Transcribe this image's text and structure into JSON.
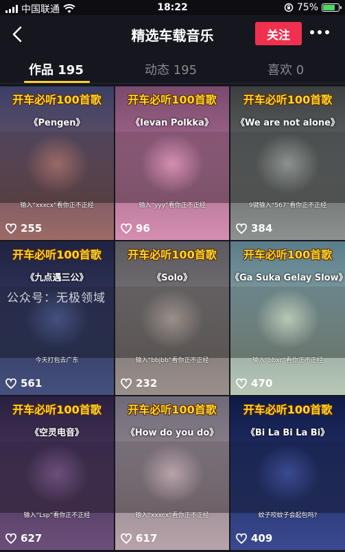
{
  "status_bar": {
    "carrier": "中国联通",
    "time": "18:22",
    "battery": "75%",
    "battery_level": 0.75
  },
  "header": {
    "title": "精选车载音乐",
    "follow_label": "关注"
  },
  "tabs": [
    {
      "label": "作品 195",
      "active": true
    },
    {
      "label": "动态 195",
      "active": false
    },
    {
      "label": "喜欢 0",
      "active": false
    }
  ],
  "videos": [
    {
      "banner": "开车必听100首歌",
      "song": "《Pengen》",
      "caption": "输入“xxxcx”看你正不正经",
      "likes": "255",
      "palette": [
        "#3a3f66",
        "#9c6a66"
      ]
    },
    {
      "banner": "开车必听100首歌",
      "song": "《Ievan Polkka》",
      "caption": "输入“yyy”看你正不正经",
      "likes": "96",
      "palette": [
        "#7a4a6e",
        "#d58fb0"
      ]
    },
    {
      "banner": "开车必听100首歌",
      "song": "《We are not alone》",
      "caption": "9键输入“567”看你正不正经",
      "likes": "384",
      "palette": [
        "#3b3f3f",
        "#8d9190"
      ]
    },
    {
      "banner": "开车必听100首歌",
      "song": "《九点遇三公》",
      "caption": "今天打包去广东",
      "likes": "561",
      "palette": [
        "#1f2240",
        "#45507e"
      ]
    },
    {
      "banner": "开车必听100首歌",
      "song": "《Solo》",
      "caption": "输入“bbjbb”看你正不正经",
      "likes": "232",
      "palette": [
        "#5a5a60",
        "#9a8f8a"
      ]
    },
    {
      "banner": "开车必听100首歌",
      "song": "《Ga Suka Gelay Slow》",
      "caption": "输入“bbxc”看你正不正经",
      "likes": "470",
      "palette": [
        "#5a7d8c",
        "#b9c7b5"
      ]
    },
    {
      "banner": "开车必听100首歌",
      "song": "《空灵电音》",
      "caption": "输入“Lsp”看你正不正经",
      "likes": "627",
      "palette": [
        "#2a2040",
        "#6d4f7a"
      ]
    },
    {
      "banner": "开车必听100首歌",
      "song": "《How do you do》",
      "caption": "输入“xxxcx”看你正不正经",
      "likes": "617",
      "palette": [
        "#6f6a78",
        "#b8a3a9"
      ]
    },
    {
      "banner": "开车必听100首歌",
      "song": "《Bi La Bi La Bi》",
      "caption": "蚊子咬蚊子会起包吗?",
      "likes": "409",
      "palette": [
        "#0f1a46",
        "#3a4a90"
      ]
    }
  ],
  "watermark": "公众号：无极领域",
  "colors": {
    "accent_red": "#f0304e",
    "tab_indicator": "#fbd12d",
    "banner_yellow": "#ffd52a",
    "background": "#16161e"
  }
}
